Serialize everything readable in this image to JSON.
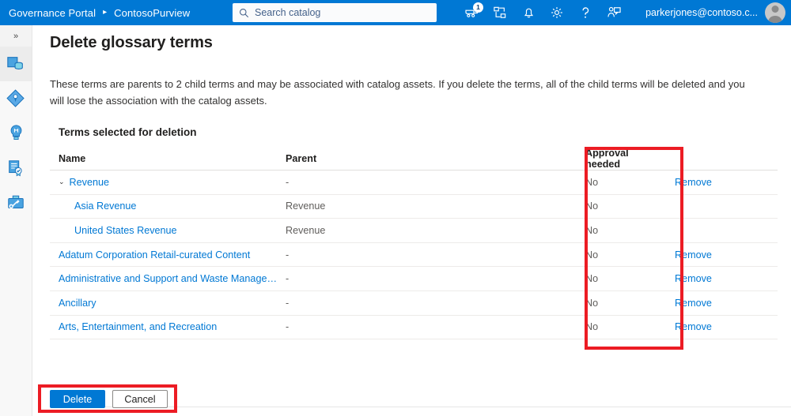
{
  "topbar": {
    "brand": "Governance Portal",
    "separator": "▸",
    "account": "ContosoPurview",
    "search": {
      "placeholder": "Search catalog",
      "value": ""
    },
    "icons": [
      {
        "name": "cart-icon",
        "badge": "1"
      },
      {
        "name": "data-map-icon",
        "badge": ""
      },
      {
        "name": "notifications-bell-icon",
        "badge": ""
      },
      {
        "name": "settings-gear-icon",
        "badge": ""
      },
      {
        "name": "help-question-icon",
        "badge": ""
      },
      {
        "name": "feedback-icon",
        "badge": ""
      }
    ],
    "user_name": "parkerjones@contoso.c..."
  },
  "rail": {
    "toggle": "»",
    "items": [
      {
        "name": "data-catalog-icon",
        "selected": true
      },
      {
        "name": "data-map-icon",
        "selected": false
      },
      {
        "name": "data-insights-icon",
        "selected": false
      },
      {
        "name": "data-policy-icon",
        "selected": false
      },
      {
        "name": "management-icon",
        "selected": false
      }
    ]
  },
  "main": {
    "title": "Delete glossary terms",
    "description": "These terms are parents to 2 child terms and may be associated with catalog assets. If you delete the terms, all of the child terms will be deleted and you will lose the association with the catalog assets.",
    "section_label": "Terms selected for deletion"
  },
  "table": {
    "columns": {
      "name": "Name",
      "parent": "Parent",
      "approval": "Approval needed",
      "action": ""
    },
    "rows": [
      {
        "name": "Revenue",
        "parent": "-",
        "approval": "No",
        "action": "Remove",
        "indent": 0,
        "expanded": true,
        "chevron": "⌄"
      },
      {
        "name": "Asia Revenue",
        "parent": "Revenue",
        "approval": "No",
        "action": "",
        "indent": 1,
        "expanded": false,
        "chevron": ""
      },
      {
        "name": "United States Revenue",
        "parent": "Revenue",
        "approval": "No",
        "action": "",
        "indent": 1,
        "expanded": false,
        "chevron": ""
      },
      {
        "name": "Adatum Corporation Retail-curated Content",
        "parent": "-",
        "approval": "No",
        "action": "Remove",
        "indent": 0,
        "expanded": false,
        "chevron": ""
      },
      {
        "name": "Administrative and Support and Waste Manage…",
        "parent": "-",
        "approval": "No",
        "action": "Remove",
        "indent": 0,
        "expanded": false,
        "chevron": ""
      },
      {
        "name": "Ancillary",
        "parent": "-",
        "approval": "No",
        "action": "Remove",
        "indent": 0,
        "expanded": false,
        "chevron": ""
      },
      {
        "name": "Arts, Entertainment, and Recreation",
        "parent": "-",
        "approval": "No",
        "action": "Remove",
        "indent": 0,
        "expanded": false,
        "chevron": ""
      }
    ]
  },
  "footer": {
    "delete_label": "Delete",
    "cancel_label": "Cancel"
  },
  "annotations": {
    "highlight_color": "#ec1c24",
    "boxes": [
      {
        "name": "approval-needed-column-highlight"
      },
      {
        "name": "action-buttons-highlight"
      }
    ]
  },
  "colors": {
    "brand_blue": "#0078d4",
    "link_blue": "#0078d4",
    "annotation_red": "#ec1c24"
  }
}
